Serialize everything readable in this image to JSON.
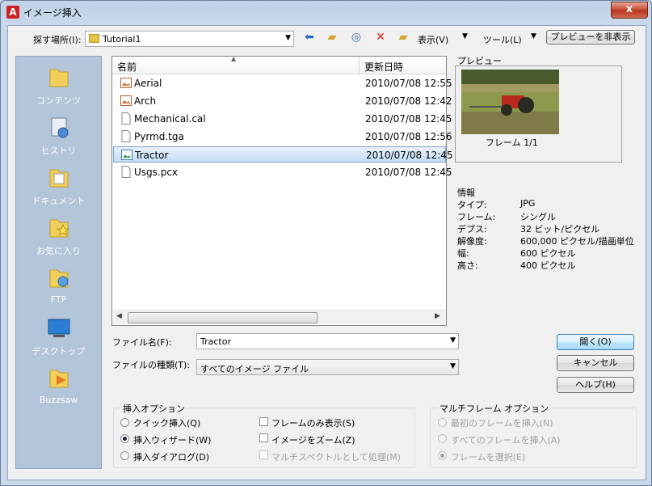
{
  "window": {
    "title": "イメージ挿入",
    "app_icon": "A",
    "close": "x"
  },
  "toolbar": {
    "look_in_label": "探す場所(I):",
    "look_in_value": "Tutorial1",
    "view_menu": "表示(V)",
    "tools_menu": "ツール(L)",
    "toggle_preview": "プレビューを非表示"
  },
  "places": [
    {
      "label": "コンテンツ",
      "icon": "folder-icon"
    },
    {
      "label": "ヒストリ",
      "icon": "history-icon"
    },
    {
      "label": "ドキュメント",
      "icon": "documents-icon"
    },
    {
      "label": "お気に入り",
      "icon": "favorites-icon"
    },
    {
      "label": "FTP",
      "icon": "ftp-icon"
    },
    {
      "label": "デスクトップ",
      "icon": "desktop-icon"
    },
    {
      "label": "Buzzsaw",
      "icon": "buzzsaw-icon"
    }
  ],
  "filelist": {
    "col_name": "名前",
    "col_date": "更新日時",
    "files": [
      {
        "name": "Aerial",
        "date": "2010/07/08 12:55",
        "icon": "image-file-icon"
      },
      {
        "name": "Arch",
        "date": "2010/07/08 12:42",
        "icon": "image-file-icon"
      },
      {
        "name": "Mechanical.cal",
        "date": "2010/07/08 12:45",
        "icon": "file-icon"
      },
      {
        "name": "Pyrmd.tga",
        "date": "2010/07/08 12:56",
        "icon": "file-icon"
      },
      {
        "name": "Tractor",
        "date": "2010/07/08 12:45",
        "icon": "image-file-icon"
      },
      {
        "name": "Usgs.pcx",
        "date": "2010/07/08 12:45",
        "icon": "file-icon"
      }
    ],
    "selected": "Tractor"
  },
  "filename": {
    "label": "ファイル名(F):",
    "value": "Tractor"
  },
  "filetype": {
    "label": "ファイルの種類(T):",
    "value": "すべてのイメージ ファイル"
  },
  "buttons": {
    "open": "開く(O)",
    "cancel": "キャンセル",
    "help": "ヘルプ(H)"
  },
  "preview": {
    "title": "プレビュー",
    "frame": "フレーム 1/1"
  },
  "info": {
    "title": "情報",
    "rows": [
      {
        "k": "タイプ:",
        "v": "JPG"
      },
      {
        "k": "フレーム:",
        "v": "シングル"
      },
      {
        "k": "デプス:",
        "v": "32 ビット/ピクセル"
      },
      {
        "k": "解像度:",
        "v": "600,000 ピクセル/描画単位"
      },
      {
        "k": "幅:",
        "v": "600 ピクセル"
      },
      {
        "k": "高さ:",
        "v": "400 ピクセル"
      }
    ]
  },
  "insert_options": {
    "title": "挿入オプション",
    "quick": "クイック挿入(Q)",
    "wizard": "挿入ウィザード(W)",
    "dialog": "挿入ダイアログ(D)",
    "frames_only": "フレームのみ表示(S)",
    "zoom": "イメージをズーム(Z)",
    "multispectral": "マルチスペクトルとして処理(M)",
    "selected": "wizard"
  },
  "multiframe_options": {
    "title": "マルチフレーム オプション",
    "first": "最初のフレームを挿入(N)",
    "all": "すべてのフレームを挿入(A)",
    "select": "フレームを選択(E)",
    "selected": "select"
  }
}
